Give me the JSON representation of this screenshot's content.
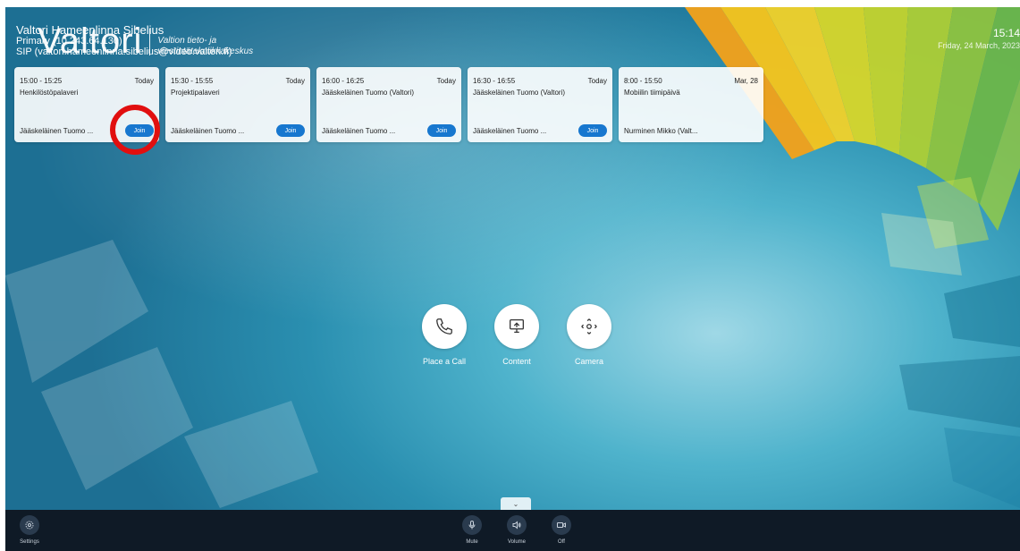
{
  "header": {
    "name": "Valtori Hameenlinna Sibelius",
    "primary": "Primary (10.243.64.130)",
    "sip": "SIP (valtori.hameenlinna.sibelius@video.valtori.fi)"
  },
  "logo": {
    "brand": "Valtori",
    "tagline": "Valtion tieto- ja viestintätekniikkakeskus"
  },
  "clock": {
    "time": "15:14",
    "date": "Friday, 24 March, 2023"
  },
  "meetings": [
    {
      "time": "15:00 - 15:25",
      "day": "Today",
      "title": "Henkilöstöpalaveri",
      "organizer": "Jääskeläinen Tuomo ...",
      "join": "Join"
    },
    {
      "time": "15:30 - 15:55",
      "day": "Today",
      "title": "Projektipalaveri",
      "organizer": "Jääskeläinen Tuomo ...",
      "join": "Join"
    },
    {
      "time": "16:00 - 16:25",
      "day": "Today",
      "title": "Jääskeläinen Tuomo (Valtori)",
      "organizer": "Jääskeläinen Tuomo ...",
      "join": "Join"
    },
    {
      "time": "16:30 - 16:55",
      "day": "Today",
      "title": "Jääskeläinen Tuomo (Valtori)",
      "organizer": "Jääskeläinen Tuomo ...",
      "join": "Join"
    },
    {
      "time": "8:00 - 15:50",
      "day": "Mar, 28",
      "title": "Mobiilin tiimipäivä",
      "organizer": "Nurminen Mikko (Valt..."
    }
  ],
  "actions": {
    "place_call": "Place a Call",
    "content": "Content",
    "camera": "Camera"
  },
  "bottom_bar": {
    "settings": "Settings",
    "mute": "Mute",
    "volume": "Volume",
    "off": "Off"
  },
  "colors": {
    "join_button": "#1777cf",
    "highlight_ring": "#e10f0f",
    "bottom_bar": "#0f1a26"
  }
}
